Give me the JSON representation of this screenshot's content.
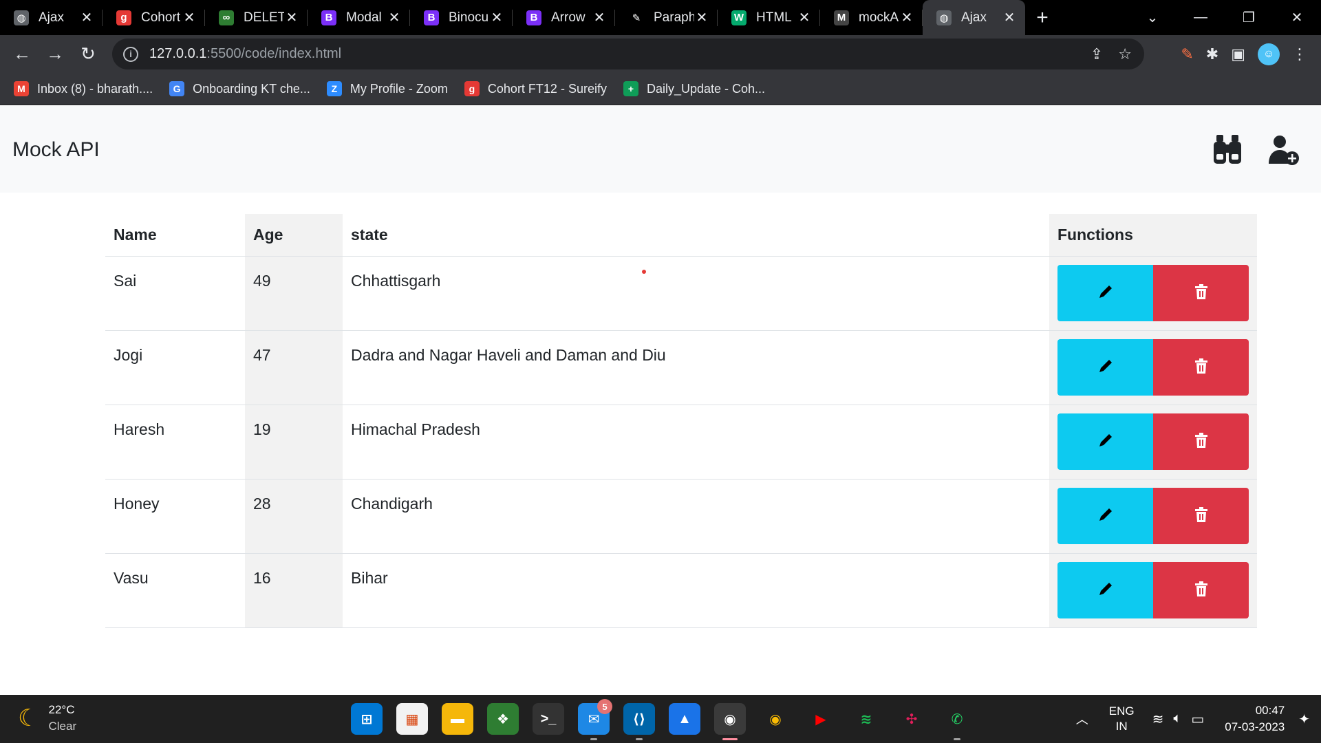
{
  "browser": {
    "tabs": [
      {
        "title": "Ajax",
        "icon": "globe-icon",
        "color": "#5f6368",
        "glyph": "◍"
      },
      {
        "title": "Cohort",
        "icon": "shield-icon",
        "color": "#e53935",
        "glyph": "g"
      },
      {
        "title": "DELETE",
        "icon": "link-icon",
        "color": "#2e7d32",
        "glyph": "∞"
      },
      {
        "title": "Modal",
        "icon": "bootstrap-icon",
        "color": "#7b2ff7",
        "glyph": "B"
      },
      {
        "title": "Binocu",
        "icon": "bootstrap-icon",
        "color": "#7b2ff7",
        "glyph": "B"
      },
      {
        "title": "Arrow",
        "icon": "bootstrap-icon",
        "color": "#7b2ff7",
        "glyph": "B"
      },
      {
        "title": "Paraph",
        "icon": "feather-icon",
        "color": "#000000",
        "glyph": "✎"
      },
      {
        "title": "HTML",
        "icon": "w3-icon",
        "color": "#04aa6d",
        "glyph": "W"
      },
      {
        "title": "mockA",
        "icon": "mockapi-icon",
        "color": "#444444",
        "glyph": "M"
      },
      {
        "title": "Ajax",
        "icon": "globe-icon",
        "color": "#5f6368",
        "glyph": "◍",
        "active": true
      }
    ],
    "url_host": "127.0.0.1",
    "url_rest": ":5500/code/index.html",
    "bookmarks": [
      {
        "label": "Inbox (8) - bharath....",
        "icon": "gmail-icon",
        "color": "#ea4335",
        "glyph": "M"
      },
      {
        "label": "Onboarding KT che...",
        "icon": "google-icon",
        "color": "#4285f4",
        "glyph": "G"
      },
      {
        "label": "My Profile - Zoom",
        "icon": "zoom-icon",
        "color": "#2d8cff",
        "glyph": "Z"
      },
      {
        "label": "Cohort FT12 - Sureify",
        "icon": "shield-icon",
        "color": "#e53935",
        "glyph": "g"
      },
      {
        "label": "Daily_Update - Coh...",
        "icon": "sheets-icon",
        "color": "#0f9d58",
        "glyph": "+"
      }
    ]
  },
  "navbar": {
    "brand": "Mock API"
  },
  "table": {
    "headers": {
      "name": "Name",
      "age": "Age",
      "state": "state",
      "functions": "Functions"
    },
    "rows": [
      {
        "name": "Sai",
        "age": "49",
        "state": "Chhattisgarh"
      },
      {
        "name": "Jogi",
        "age": "47",
        "state": "Dadra and Nagar Haveli and Daman and Diu"
      },
      {
        "name": "Haresh",
        "age": "19",
        "state": "Himachal Pradesh"
      },
      {
        "name": "Honey",
        "age": "28",
        "state": "Chandigarh"
      },
      {
        "name": "Vasu",
        "age": "16",
        "state": "Bihar"
      }
    ]
  },
  "colors": {
    "edit": "#0dcaf0",
    "delete": "#dc3545"
  },
  "taskbar": {
    "temperature": "22°C",
    "condition": "Clear",
    "mail_badge": "5",
    "lang": "ENG",
    "region": "IN",
    "time": "00:47",
    "date": "07-03-2023"
  }
}
